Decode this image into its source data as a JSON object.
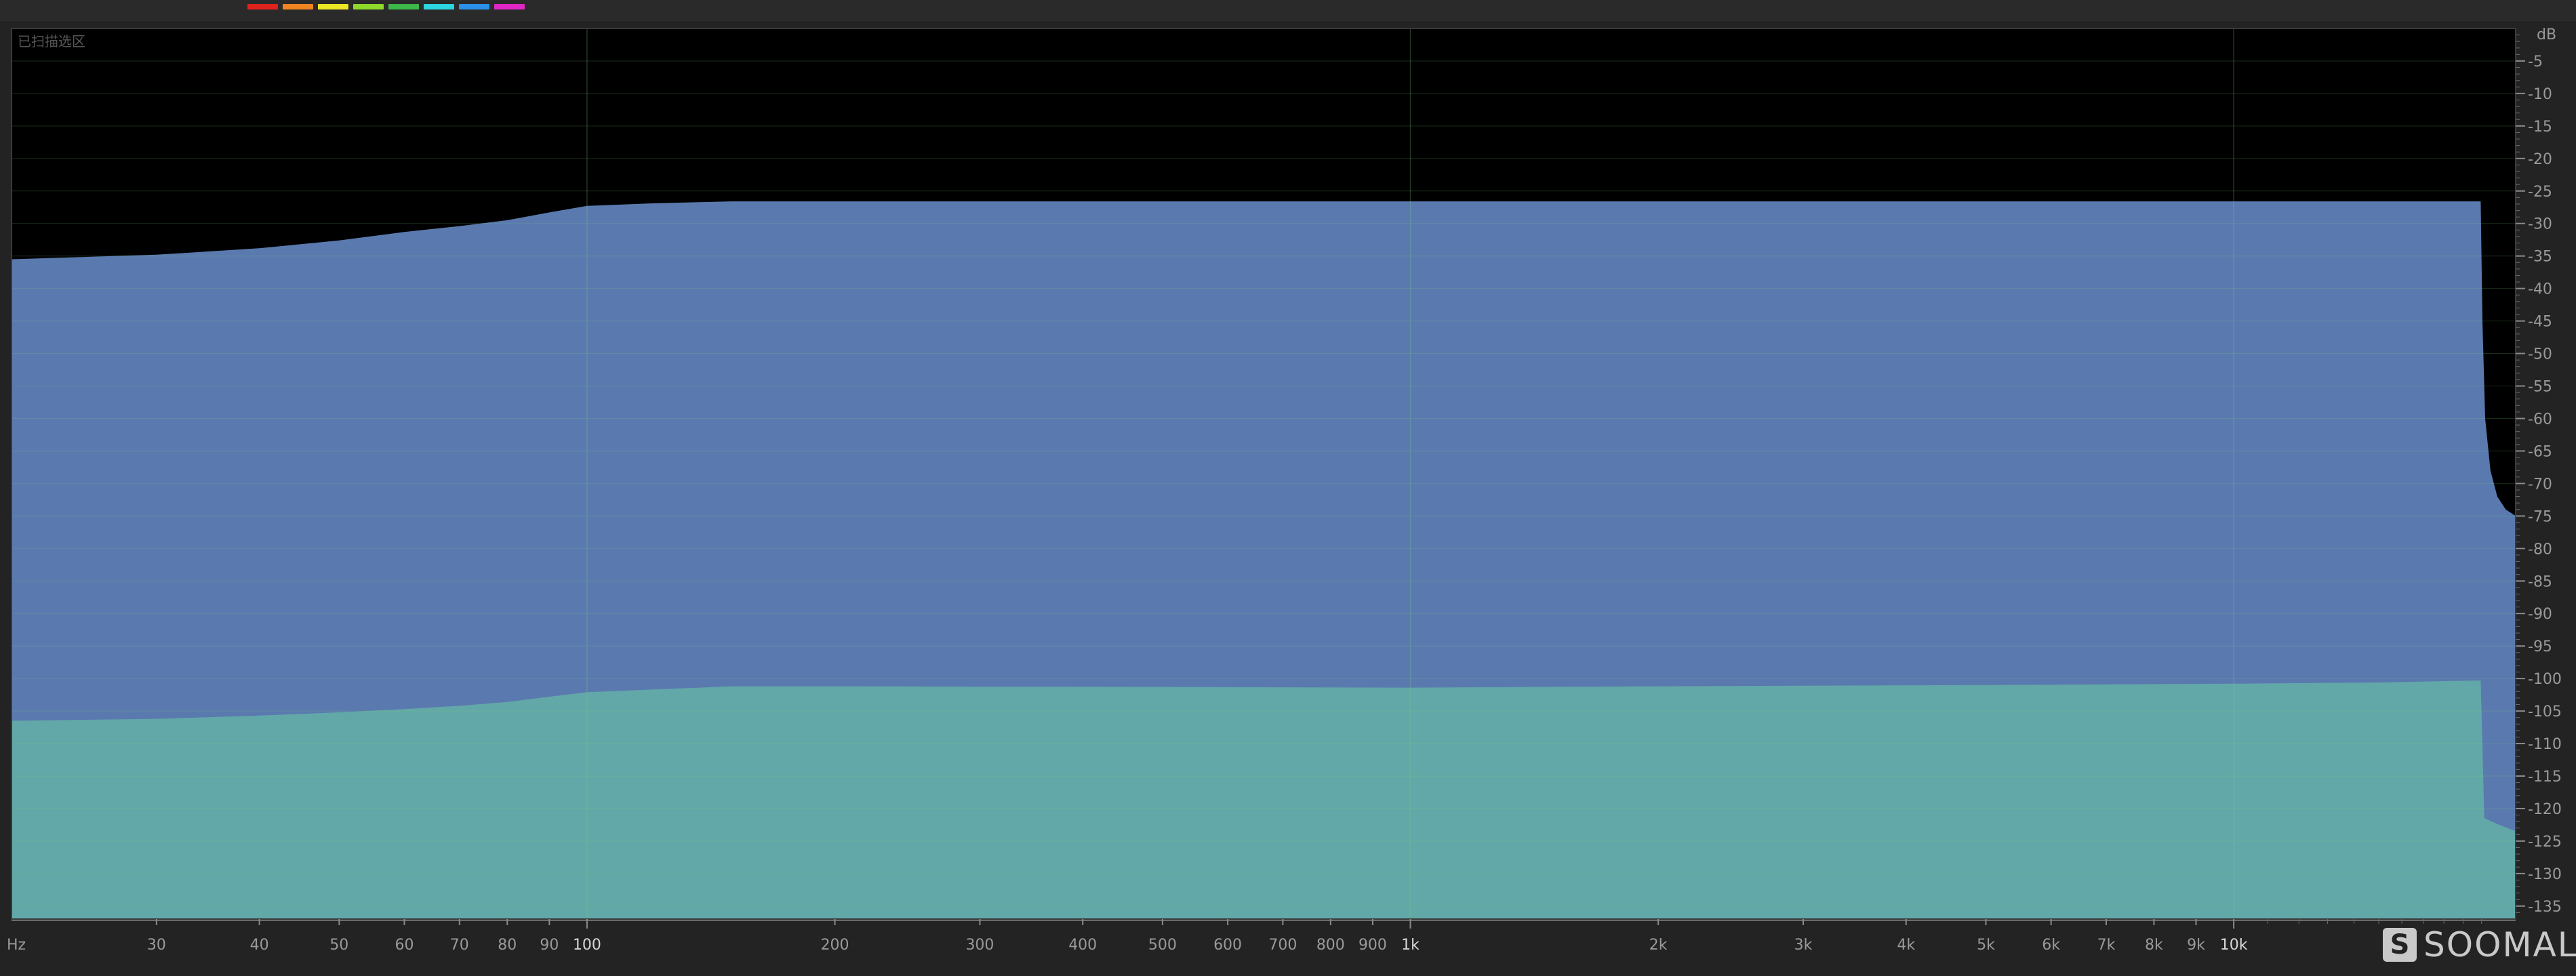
{
  "toolbar": {
    "colors": [
      "#e0221f",
      "#f08522",
      "#ece724",
      "#8ed82a",
      "#3db84a",
      "#2bd6e0",
      "#2a90e8",
      "#e026c4"
    ]
  },
  "logo": {
    "text": "SOOMAL",
    "mark": "S",
    "icon": "soomal-logo-icon"
  },
  "chart_data": {
    "type": "area",
    "title": "",
    "annotation": "已扫描选区",
    "x_scale": "log",
    "xlim": [
      20,
      22000
    ],
    "ylim": [
      -137,
      0
    ],
    "x_unit_label": "Hz",
    "y_unit_label": "dB",
    "x_ticks": [
      {
        "v": 30,
        "label": "30"
      },
      {
        "v": 40,
        "label": "40"
      },
      {
        "v": 50,
        "label": "50"
      },
      {
        "v": 60,
        "label": "60"
      },
      {
        "v": 70,
        "label": "70"
      },
      {
        "v": 80,
        "label": "80"
      },
      {
        "v": 90,
        "label": "90"
      },
      {
        "v": 100,
        "label": "100"
      },
      {
        "v": 200,
        "label": "200"
      },
      {
        "v": 300,
        "label": "300"
      },
      {
        "v": 400,
        "label": "400"
      },
      {
        "v": 500,
        "label": "500"
      },
      {
        "v": 600,
        "label": "600"
      },
      {
        "v": 700,
        "label": "700"
      },
      {
        "v": 800,
        "label": "800"
      },
      {
        "v": 900,
        "label": "900"
      },
      {
        "v": 1000,
        "label": "1k"
      },
      {
        "v": 2000,
        "label": "2k"
      },
      {
        "v": 3000,
        "label": "3k"
      },
      {
        "v": 4000,
        "label": "4k"
      },
      {
        "v": 5000,
        "label": "5k"
      },
      {
        "v": 6000,
        "label": "6k"
      },
      {
        "v": 7000,
        "label": "7k"
      },
      {
        "v": 8000,
        "label": "8k"
      },
      {
        "v": 9000,
        "label": "9k"
      },
      {
        "v": 10000,
        "label": "10k"
      }
    ],
    "x_major_grid": [
      100,
      1000,
      10000
    ],
    "y_ticks": [
      -5,
      -10,
      -15,
      -20,
      -25,
      -30,
      -35,
      -40,
      -45,
      -50,
      -55,
      -60,
      -65,
      -70,
      -75,
      -80,
      -85,
      -90,
      -95,
      -100,
      -105,
      -110,
      -115,
      -120,
      -125,
      -130,
      -135
    ],
    "grid": true,
    "series": [
      {
        "color": "#5a7aaf",
        "points": [
          [
            20,
            -35.5
          ],
          [
            30,
            -34.8
          ],
          [
            40,
            -33.8
          ],
          [
            50,
            -32.6
          ],
          [
            60,
            -31.3
          ],
          [
            70,
            -30.4
          ],
          [
            80,
            -29.5
          ],
          [
            90,
            -28.3
          ],
          [
            100,
            -27.3
          ],
          [
            120,
            -26.9
          ],
          [
            150,
            -26.6
          ],
          [
            200,
            -26.6
          ],
          [
            1000,
            -26.6
          ],
          [
            10000,
            -26.6
          ],
          [
            19950,
            -26.6
          ],
          [
            20050,
            -45
          ],
          [
            20200,
            -60
          ],
          [
            20500,
            -68
          ],
          [
            20900,
            -72
          ],
          [
            21400,
            -74
          ],
          [
            22000,
            -75
          ]
        ]
      },
      {
        "color": "#63a8a8",
        "points": [
          [
            20,
            -106.5
          ],
          [
            30,
            -106.2
          ],
          [
            40,
            -105.7
          ],
          [
            50,
            -105.2
          ],
          [
            60,
            -104.7
          ],
          [
            70,
            -104.2
          ],
          [
            80,
            -103.6
          ],
          [
            90,
            -102.8
          ],
          [
            100,
            -102.1
          ],
          [
            150,
            -101.2
          ],
          [
            200,
            -101.2
          ],
          [
            500,
            -101.3
          ],
          [
            1000,
            -101.4
          ],
          [
            2000,
            -101.2
          ],
          [
            5000,
            -101
          ],
          [
            10000,
            -100.8
          ],
          [
            15000,
            -100.6
          ],
          [
            19950,
            -100.3
          ],
          [
            20150,
            -121.5
          ],
          [
            21000,
            -122.5
          ],
          [
            22000,
            -123.5
          ]
        ]
      }
    ]
  }
}
